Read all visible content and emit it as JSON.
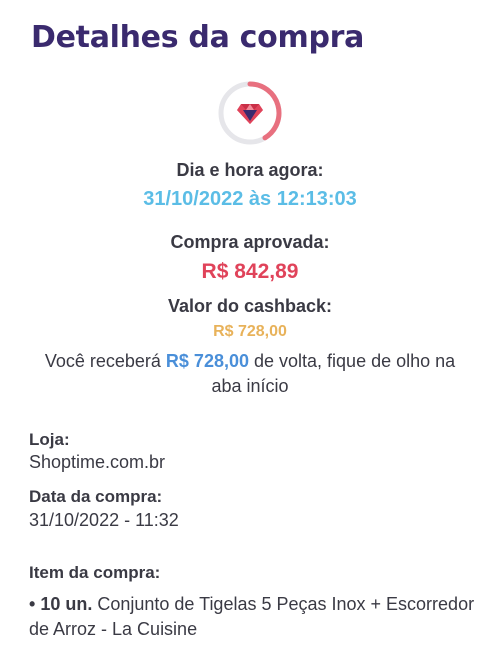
{
  "header": {
    "title": "Detalhes da compra"
  },
  "status": {
    "icon": "heart-gem-icon",
    "colors": {
      "accent": "#e0435a",
      "ring": "#e6e6ea"
    }
  },
  "summary": {
    "now_label": "Dia e hora agora:",
    "now_value": "31/10/2022 às 12:13:03",
    "approved_label": "Compra aprovada:",
    "approved_amount": "R$ 842,89",
    "cashback_label": "Valor do cashback:",
    "cashback_amount": "R$ 728,00",
    "notice_prefix": "Você receberá ",
    "notice_amount": "R$ 728,00",
    "notice_suffix": " de volta, fique de olho na aba início"
  },
  "details": {
    "store_label": "Loja:",
    "store_value": "Shoptime.com.br",
    "date_label": "Data da compra:",
    "date_value": "31/10/2022 - 11:32",
    "item_label": "Item da compra:",
    "item_bullet": "•",
    "item_qty": "10 un.",
    "item_name": "Conjunto de Tigelas 5 Peças Inox + Escorredor de Arroz - La Cuisine"
  }
}
